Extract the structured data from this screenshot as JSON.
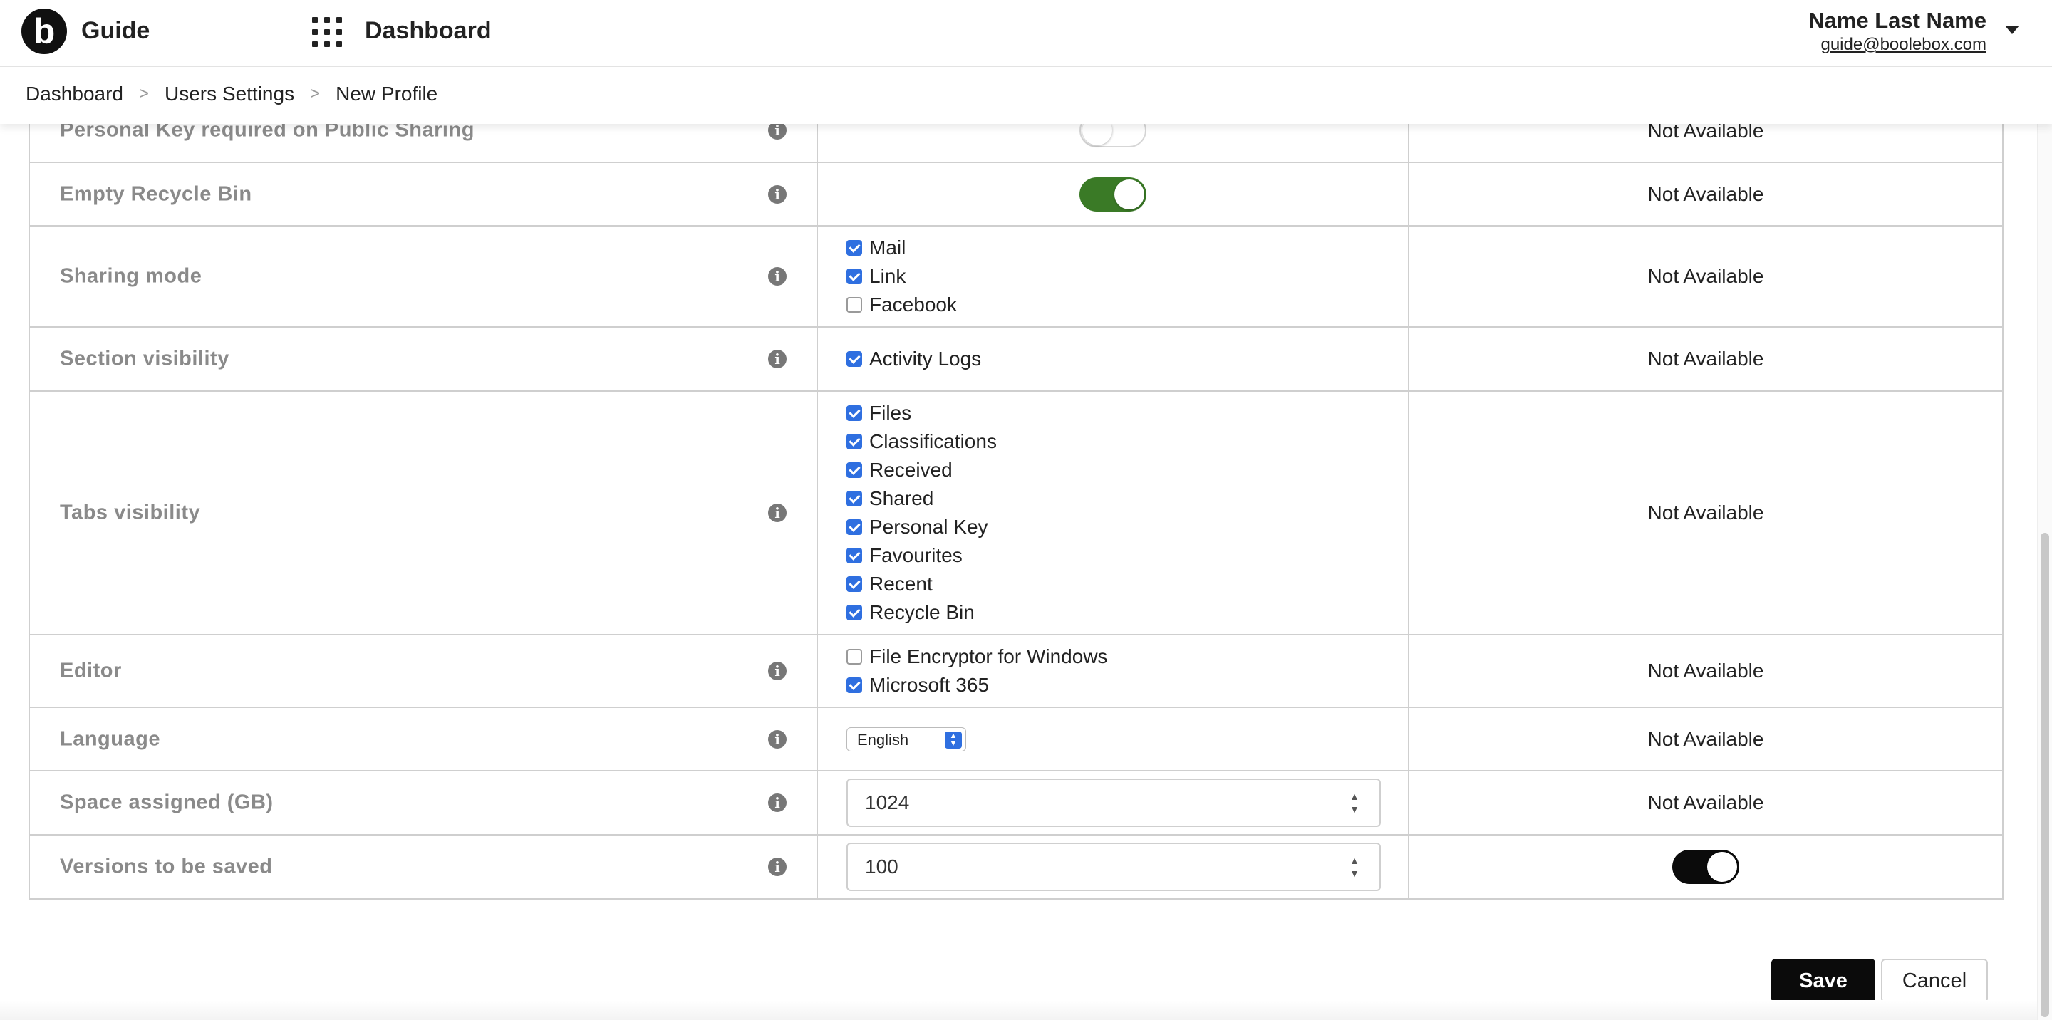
{
  "header": {
    "logo_letter": "b",
    "app_name": "Guide",
    "nav_title": "Dashboard",
    "user_name": "Name Last Name",
    "user_email": "guide@boolebox.com"
  },
  "breadcrumb": {
    "items": [
      "Dashboard",
      "Users Settings",
      "New Profile"
    ],
    "separator": ">"
  },
  "info_icon_glyph": "i",
  "rows": {
    "personal_key": {
      "label": "Personal Key required on Public Sharing",
      "toggle": false,
      "availability": "Not Available"
    },
    "empty_recycle_bin": {
      "label": "Empty Recycle Bin",
      "toggle": true,
      "availability": "Not Available"
    },
    "sharing_mode": {
      "label": "Sharing mode",
      "options": [
        {
          "label": "Mail",
          "checked": true
        },
        {
          "label": "Link",
          "checked": true
        },
        {
          "label": "Facebook",
          "checked": false
        }
      ],
      "availability": "Not Available"
    },
    "section_visibility": {
      "label": "Section visibility",
      "options": [
        {
          "label": "Activity Logs",
          "checked": true
        }
      ],
      "availability": "Not Available"
    },
    "tabs_visibility": {
      "label": "Tabs visibility",
      "options": [
        {
          "label": "Files",
          "checked": true
        },
        {
          "label": "Classifications",
          "checked": true
        },
        {
          "label": "Received",
          "checked": true
        },
        {
          "label": "Shared",
          "checked": true
        },
        {
          "label": "Personal Key",
          "checked": true
        },
        {
          "label": "Favourites",
          "checked": true
        },
        {
          "label": "Recent",
          "checked": true
        },
        {
          "label": "Recycle Bin",
          "checked": true
        }
      ],
      "availability": "Not Available"
    },
    "editor": {
      "label": "Editor",
      "options": [
        {
          "label": "File Encryptor for Windows",
          "checked": false
        },
        {
          "label": "Microsoft 365",
          "checked": true
        }
      ],
      "availability": "Not Available"
    },
    "language": {
      "label": "Language",
      "selected": "English",
      "availability": "Not Available"
    },
    "space_assigned": {
      "label": "Space assigned (GB)",
      "value": "1024",
      "availability": "Not Available"
    },
    "versions_saved": {
      "label": "Versions to be saved",
      "value": "100",
      "toggle": true
    }
  },
  "actions": {
    "save_label": "Save",
    "cancel_label": "Cancel"
  },
  "colors": {
    "toggle_green": "#3a7a26",
    "toggle_black": "#0b0b0b",
    "checkbox_blue": "#2f6fe0"
  }
}
